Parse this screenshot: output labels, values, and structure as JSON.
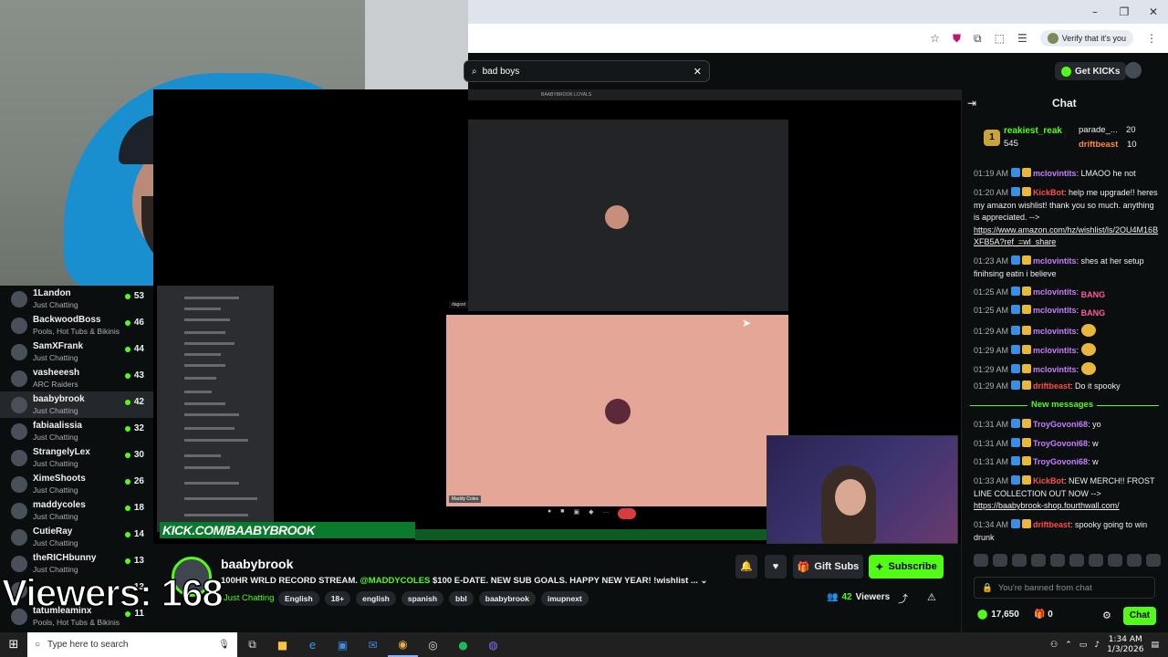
{
  "browser": {
    "verify_label": "Verify that it's you",
    "window_controls": [
      "–",
      "❐",
      "✕"
    ]
  },
  "search": {
    "value": "bad boys",
    "clear_icon": "close-icon"
  },
  "header": {
    "get_kicks_label": "Get KICKs"
  },
  "following": [
    {
      "name": "1Landon",
      "sub": "Just Chatting",
      "count": "53"
    },
    {
      "name": "BackwoodBoss",
      "sub": "Pools, Hot Tubs & Bikinis",
      "count": "46"
    },
    {
      "name": "SamXFrank",
      "sub": "Just Chatting",
      "count": "44"
    },
    {
      "name": "vasheeesh",
      "sub": "ARC Raiders",
      "count": "43"
    },
    {
      "name": "baabybrook",
      "sub": "Just Chatting",
      "count": "42"
    },
    {
      "name": "fabiaalissia",
      "sub": "Just Chatting",
      "count": "32"
    },
    {
      "name": "StrangelyLex",
      "sub": "Just Chatting",
      "count": "30"
    },
    {
      "name": "XimeShoots",
      "sub": "Just Chatting",
      "count": "26"
    },
    {
      "name": "maddycoles",
      "sub": "Just Chatting",
      "count": "18"
    },
    {
      "name": "CutieRay",
      "sub": "Just Chatting",
      "count": "14"
    },
    {
      "name": "theRICHbunny",
      "sub": "Just Chatting",
      "count": "13"
    },
    {
      "name": "",
      "sub": "",
      "count": "13"
    },
    {
      "name": "tatumleaminx",
      "sub": "Pools, Hot Tubs & Bikinis",
      "count": "11"
    }
  ],
  "video": {
    "overlay_text": "KICK.COM/BAABYBROOK",
    "discord_header": "BAABYBROOK LOYALS",
    "tile1_label": "dagost",
    "tile2_label": "Maddy Coles"
  },
  "viewers_overlay": "Viewers: 168",
  "stream": {
    "streamer_name": "baabybrook",
    "title_prefix": "100HR WRLD RECORD STREAM. ",
    "title_mention": "@MADDYCOLES",
    "title_suffix": " $100 E-DATE. NEW SUB GOALS. HAPPY NEW YEAR! !wishlist ...",
    "category": "Just Chatting",
    "tags": [
      "English",
      "18+",
      "english",
      "spanish",
      "bbl",
      "baabybrook",
      "imupnext"
    ],
    "gift_subs_label": "Gift Subs",
    "subscribe_label": "Subscribe",
    "viewers_count": "42",
    "viewers_label": "Viewers"
  },
  "chat": {
    "title": "Chat",
    "leaderboard": [
      {
        "rank": "1",
        "name": "reakiest_reak",
        "count": "545"
      },
      {
        "name": "parade_...",
        "count": "20"
      },
      {
        "name": "driftbeast",
        "count": "10"
      }
    ],
    "messages": [
      {
        "time": "01:19 AM",
        "user": "mclovintits",
        "user_color": "#c77dff",
        "text": ": LMAOO he not"
      },
      {
        "time": "01:20 AM",
        "user": "KickBot",
        "user_color": "#ff4d4d",
        "text": ": help me upgrade!! heres my amazon wishlist! thank you so much. anything is appreciated. -->",
        "link": "https://www.amazon.com/hz/wishlist/ls/2OU4M16BXFB5A?ref_=wl_share"
      },
      {
        "time": "01:23 AM",
        "user": "mclovintits",
        "user_color": "#c77dff",
        "text": ": shes at her setup finihsing eatin i believe"
      },
      {
        "time": "01:25 AM",
        "user": "mclovintits",
        "user_color": "#c77dff",
        "text": ":",
        "emote": "BANG"
      },
      {
        "time": "01:25 AM",
        "user": "mclovintits",
        "user_color": "#c77dff",
        "text": ":",
        "emote": "BANG"
      },
      {
        "time": "01:29 AM",
        "user": "mclovintits",
        "user_color": "#c77dff",
        "text": ":",
        "emote": "face"
      },
      {
        "time": "01:29 AM",
        "user": "mclovintits",
        "user_color": "#c77dff",
        "text": ":",
        "emote": "face"
      },
      {
        "time": "01:29 AM",
        "user": "mclovintits",
        "user_color": "#c77dff",
        "text": ":",
        "emote": "face"
      },
      {
        "time": "01:29 AM",
        "user": "driftbeast",
        "user_color": "#ff4d4d",
        "text": ": Do it spooky"
      }
    ],
    "new_messages_label": "New messages",
    "new_messages": [
      {
        "time": "01:31 AM",
        "user": "TroyGovoni68",
        "user_color": "#c77dff",
        "text": ": yo"
      },
      {
        "time": "01:31 AM",
        "user": "TroyGovoni68",
        "user_color": "#c77dff",
        "text": ": w"
      },
      {
        "time": "01:31 AM",
        "user": "TroyGovoni68",
        "user_color": "#c77dff",
        "text": ": w"
      },
      {
        "time": "01:33 AM",
        "user": "KickBot",
        "user_color": "#ff4d4d",
        "text": ": NEW MERCH!! FROST LINE COLLECTION OUT NOW -->",
        "link": "https://baabybrook-shop.fourthwall.com/"
      },
      {
        "time": "01:34 AM",
        "user": "driftbeast",
        "user_color": "#ff4d4d",
        "text": ": spooky going to win drunk"
      }
    ],
    "banned_label": "You're banned from chat",
    "points": "17,650",
    "gifts": "0",
    "chat_button": "Chat"
  },
  "taskbar": {
    "search_placeholder": "Type here to search",
    "time": "1:34 AM",
    "date": "1/3/2026"
  },
  "colors": {
    "accent": "#53fc18",
    "bg": "#0b0e0f",
    "panel": "#24272c"
  }
}
